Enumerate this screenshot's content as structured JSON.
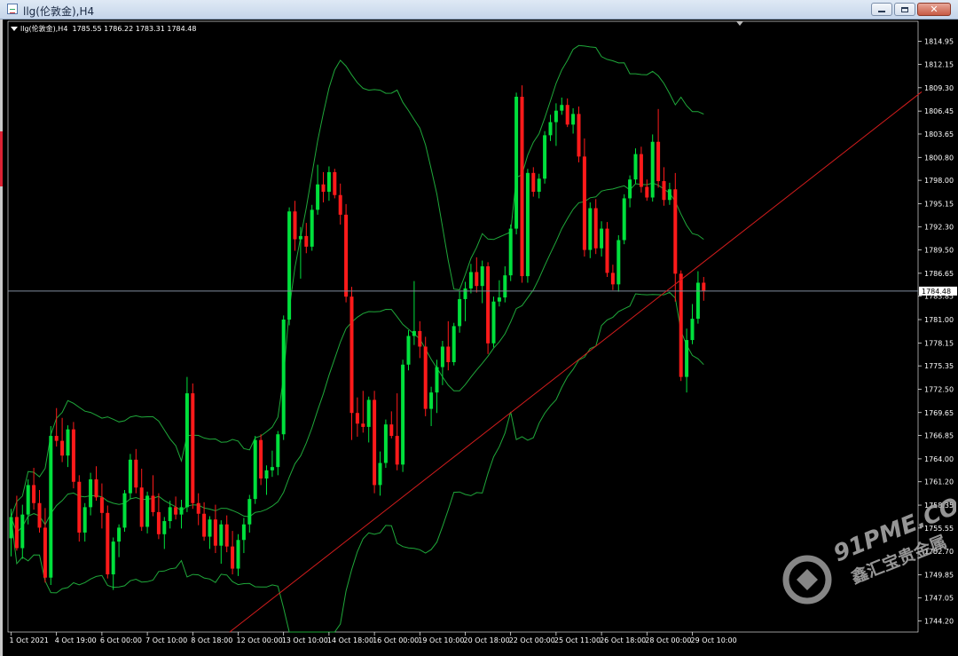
{
  "window": {
    "title": "llg(伦敦金),H4",
    "icon": "chart-window-icon",
    "controls": {
      "minimize": "minimize-icon",
      "maximize": "restore-icon",
      "close": "close-icon"
    }
  },
  "chart_info": "llg(伦敦金),H4  1785.55 1786.22 1783.31 1784.48",
  "watermark": {
    "brand": "91PME.COM",
    "tagline": "鑫汇宝贵金属"
  },
  "colors": {
    "background": "#000000",
    "bull": "#00e03c",
    "bear": "#ff1a1a",
    "band": "#1fa83a",
    "trendline": "#d21c1c",
    "price_line": "#7f8c9e"
  },
  "chart_data": {
    "type": "candlestick",
    "symbol": "llg(伦敦金)",
    "timeframe": "H4",
    "ylim": [
      1742.86,
      1816.0
    ],
    "y_ticks": [
      "1814.95",
      "1812.15",
      "1809.30",
      "1806.45",
      "1803.65",
      "1800.80",
      "1798.00",
      "1795.15",
      "1792.30",
      "1789.50",
      "1786.65",
      "1783.85",
      "1781.00",
      "1778.15",
      "1775.35",
      "1772.50",
      "1769.65",
      "1766.85",
      "1764.00",
      "1761.20",
      "1758.35",
      "1755.55",
      "1752.70",
      "1749.85",
      "1747.05",
      "1744.20"
    ],
    "x_ticks": [
      {
        "label": "1 Oct 2021",
        "i": 0
      },
      {
        "label": "4 Oct 19:00",
        "i": 8
      },
      {
        "label": "6 Oct 00:00",
        "i": 16
      },
      {
        "label": "7 Oct 10:00",
        "i": 24
      },
      {
        "label": "8 Oct 18:00",
        "i": 32
      },
      {
        "label": "12 Oct 00:00",
        "i": 40
      },
      {
        "label": "13 Oct 10:00",
        "i": 48
      },
      {
        "label": "14 Oct 18:00",
        "i": 56
      },
      {
        "label": "16 Oct 00:00",
        "i": 64
      },
      {
        "label": "19 Oct 10:00",
        "i": 72
      },
      {
        "label": "20 Oct 18:00",
        "i": 80
      },
      {
        "label": "22 Oct 00:00",
        "i": 88
      },
      {
        "label": "25 Oct 11:00",
        "i": 96
      },
      {
        "label": "26 Oct 18:00",
        "i": 104
      },
      {
        "label": "28 Oct 00:00",
        "i": 112
      },
      {
        "label": "29 Oct 10:00",
        "i": 120
      }
    ],
    "last_price": 1784.48,
    "ohlc": [
      [
        1754.3,
        1757.9,
        1752.1,
        1756.9
      ],
      [
        1756.9,
        1759.5,
        1752.8,
        1753.1
      ],
      [
        1753.1,
        1758.4,
        1751.8,
        1757.2
      ],
      [
        1757.2,
        1761.5,
        1756.0,
        1760.8
      ],
      [
        1760.8,
        1762.9,
        1757.8,
        1758.6
      ],
      [
        1758.6,
        1760.2,
        1755.0,
        1755.6
      ],
      [
        1755.6,
        1758.0,
        1748.9,
        1749.5
      ],
      [
        1749.5,
        1768.0,
        1748.6,
        1766.8
      ],
      [
        1766.8,
        1770.2,
        1765.5,
        1766.2
      ],
      [
        1766.2,
        1769.0,
        1763.6,
        1764.4
      ],
      [
        1764.4,
        1768.1,
        1763.0,
        1767.6
      ],
      [
        1767.6,
        1768.5,
        1760.4,
        1761.2
      ],
      [
        1761.2,
        1762.0,
        1753.9,
        1755.0
      ],
      [
        1755.0,
        1758.6,
        1753.9,
        1758.1
      ],
      [
        1758.1,
        1762.3,
        1757.1,
        1761.5
      ],
      [
        1761.5,
        1763.1,
        1758.9,
        1759.3
      ],
      [
        1759.3,
        1761.0,
        1755.5,
        1757.4
      ],
      [
        1757.4,
        1758.3,
        1749.4,
        1749.9
      ],
      [
        1749.9,
        1754.4,
        1748.0,
        1753.9
      ],
      [
        1753.9,
        1756.0,
        1752.0,
        1755.6
      ],
      [
        1755.6,
        1760.2,
        1755.1,
        1759.8
      ],
      [
        1759.8,
        1764.6,
        1759.1,
        1763.9
      ],
      [
        1763.9,
        1765.2,
        1759.8,
        1760.5
      ],
      [
        1760.5,
        1762.8,
        1755.2,
        1755.7
      ],
      [
        1755.7,
        1760.0,
        1754.9,
        1759.5
      ],
      [
        1759.5,
        1762.0,
        1757.0,
        1757.5
      ],
      [
        1757.5,
        1759.8,
        1754.2,
        1754.8
      ],
      [
        1754.8,
        1756.9,
        1753.0,
        1756.4
      ],
      [
        1756.4,
        1758.9,
        1755.5,
        1758.1
      ],
      [
        1758.1,
        1759.4,
        1756.6,
        1757.2
      ],
      [
        1757.2,
        1759.0,
        1755.5,
        1758.1
      ],
      [
        1758.1,
        1774.0,
        1757.5,
        1772.0
      ],
      [
        1772.0,
        1773.2,
        1757.9,
        1758.6
      ],
      [
        1758.6,
        1759.8,
        1755.9,
        1757.3
      ],
      [
        1757.3,
        1758.7,
        1754.0,
        1754.5
      ],
      [
        1754.5,
        1757.0,
        1753.0,
        1756.6
      ],
      [
        1756.6,
        1758.4,
        1752.5,
        1753.4
      ],
      [
        1753.4,
        1756.5,
        1751.2,
        1756.0
      ],
      [
        1756.0,
        1757.1,
        1752.6,
        1753.3
      ],
      [
        1753.3,
        1755.2,
        1749.9,
        1750.6
      ],
      [
        1750.6,
        1754.8,
        1749.7,
        1754.1
      ],
      [
        1754.1,
        1756.8,
        1752.5,
        1756.0
      ],
      [
        1756.0,
        1759.6,
        1755.0,
        1759.1
      ],
      [
        1759.1,
        1766.8,
        1758.5,
        1766.3
      ],
      [
        1766.3,
        1767.0,
        1760.8,
        1761.6
      ],
      [
        1761.6,
        1763.2,
        1759.6,
        1762.6
      ],
      [
        1762.6,
        1765.0,
        1761.8,
        1763.0
      ],
      [
        1763.0,
        1767.4,
        1762.0,
        1767.0
      ],
      [
        1767.0,
        1781.5,
        1766.3,
        1781.0
      ],
      [
        1781.0,
        1794.7,
        1780.3,
        1794.2
      ],
      [
        1794.2,
        1795.5,
        1789.4,
        1790.8
      ],
      [
        1790.8,
        1792.3,
        1786.0,
        1791.2
      ],
      [
        1791.2,
        1792.8,
        1789.1,
        1789.9
      ],
      [
        1789.9,
        1795.0,
        1789.4,
        1794.4
      ],
      [
        1794.4,
        1799.9,
        1793.8,
        1797.5
      ],
      [
        1797.5,
        1799.0,
        1795.3,
        1796.6
      ],
      [
        1796.6,
        1799.7,
        1795.5,
        1799.0
      ],
      [
        1799.0,
        1799.4,
        1795.8,
        1796.2
      ],
      [
        1796.2,
        1797.6,
        1792.6,
        1793.8
      ],
      [
        1793.8,
        1795.1,
        1783.1,
        1783.8
      ],
      [
        1783.8,
        1785.0,
        1766.3,
        1769.6
      ],
      [
        1769.6,
        1771.5,
        1766.7,
        1768.3
      ],
      [
        1768.3,
        1772.3,
        1767.2,
        1767.9
      ],
      [
        1767.9,
        1771.6,
        1766.0,
        1771.2
      ],
      [
        1771.2,
        1772.3,
        1759.8,
        1760.8
      ],
      [
        1760.8,
        1764.9,
        1759.5,
        1763.5
      ],
      [
        1763.5,
        1768.8,
        1762.9,
        1768.2
      ],
      [
        1768.2,
        1769.8,
        1766.5,
        1766.8
      ],
      [
        1766.8,
        1772.0,
        1762.6,
        1763.3
      ],
      [
        1763.3,
        1776.1,
        1762.4,
        1775.5
      ],
      [
        1775.5,
        1779.7,
        1774.8,
        1779.0
      ],
      [
        1779.0,
        1785.7,
        1777.9,
        1779.6
      ],
      [
        1779.6,
        1780.8,
        1776.3,
        1777.7
      ],
      [
        1777.7,
        1778.9,
        1769.2,
        1770.1
      ],
      [
        1770.1,
        1772.8,
        1768.0,
        1772.1
      ],
      [
        1772.1,
        1776.1,
        1769.6,
        1775.2
      ],
      [
        1775.2,
        1778.4,
        1773.0,
        1777.7
      ],
      [
        1777.7,
        1780.8,
        1774.8,
        1775.8
      ],
      [
        1775.8,
        1780.6,
        1775.4,
        1780.2
      ],
      [
        1780.2,
        1784.5,
        1779.4,
        1783.5
      ],
      [
        1783.5,
        1785.6,
        1780.8,
        1784.8
      ],
      [
        1784.8,
        1787.8,
        1784.2,
        1786.8
      ],
      [
        1786.8,
        1788.6,
        1784.3,
        1785.1
      ],
      [
        1785.1,
        1788.2,
        1783.0,
        1787.5
      ],
      [
        1787.5,
        1788.0,
        1776.8,
        1778.1
      ],
      [
        1778.1,
        1783.8,
        1777.6,
        1783.2
      ],
      [
        1783.2,
        1785.8,
        1782.6,
        1783.7
      ],
      [
        1783.7,
        1787.5,
        1783.1,
        1786.4
      ],
      [
        1786.4,
        1792.6,
        1785.7,
        1792.1
      ],
      [
        1792.1,
        1808.7,
        1791.4,
        1808.2
      ],
      [
        1808.2,
        1809.6,
        1785.5,
        1786.3
      ],
      [
        1786.3,
        1799.4,
        1785.5,
        1798.9
      ],
      [
        1798.9,
        1799.6,
        1796.0,
        1796.6
      ],
      [
        1796.6,
        1798.8,
        1795.8,
        1798.2
      ],
      [
        1798.2,
        1804.0,
        1797.6,
        1803.5
      ],
      [
        1803.5,
        1806.0,
        1802.8,
        1805.1
      ],
      [
        1805.1,
        1807.4,
        1802.2,
        1806.5
      ],
      [
        1806.5,
        1808.1,
        1806.0,
        1807.2
      ],
      [
        1807.2,
        1808.0,
        1804.5,
        1804.8
      ],
      [
        1804.8,
        1806.8,
        1803.7,
        1806.1
      ],
      [
        1806.1,
        1807.0,
        1800.2,
        1800.9
      ],
      [
        1800.9,
        1803.1,
        1788.7,
        1789.5
      ],
      [
        1789.5,
        1795.3,
        1788.5,
        1794.6
      ],
      [
        1794.6,
        1795.7,
        1789.0,
        1789.7
      ],
      [
        1789.7,
        1793.0,
        1788.7,
        1792.1
      ],
      [
        1792.1,
        1792.9,
        1786.2,
        1786.7
      ],
      [
        1786.7,
        1787.7,
        1784.6,
        1785.3
      ],
      [
        1785.3,
        1791.3,
        1784.4,
        1790.7
      ],
      [
        1790.7,
        1796.3,
        1790.2,
        1795.8
      ],
      [
        1795.8,
        1798.6,
        1794.7,
        1798.1
      ],
      [
        1798.1,
        1801.9,
        1797.6,
        1801.2
      ],
      [
        1801.2,
        1802.1,
        1796.5,
        1797.2
      ],
      [
        1797.2,
        1798.1,
        1795.5,
        1795.9
      ],
      [
        1795.9,
        1803.6,
        1795.4,
        1802.7
      ],
      [
        1802.7,
        1806.7,
        1797.1,
        1797.9
      ],
      [
        1797.9,
        1799.6,
        1794.9,
        1795.6
      ],
      [
        1795.6,
        1797.7,
        1795.0,
        1796.9
      ],
      [
        1796.9,
        1798.9,
        1783.2,
        1786.6
      ],
      [
        1786.6,
        1787.0,
        1773.5,
        1774.0
      ],
      [
        1774.0,
        1779.9,
        1772.1,
        1778.5
      ],
      [
        1778.5,
        1782.9,
        1778.0,
        1781.1
      ],
      [
        1781.1,
        1786.9,
        1780.5,
        1785.5
      ],
      [
        1785.5,
        1786.2,
        1783.3,
        1784.5
      ]
    ]
  }
}
